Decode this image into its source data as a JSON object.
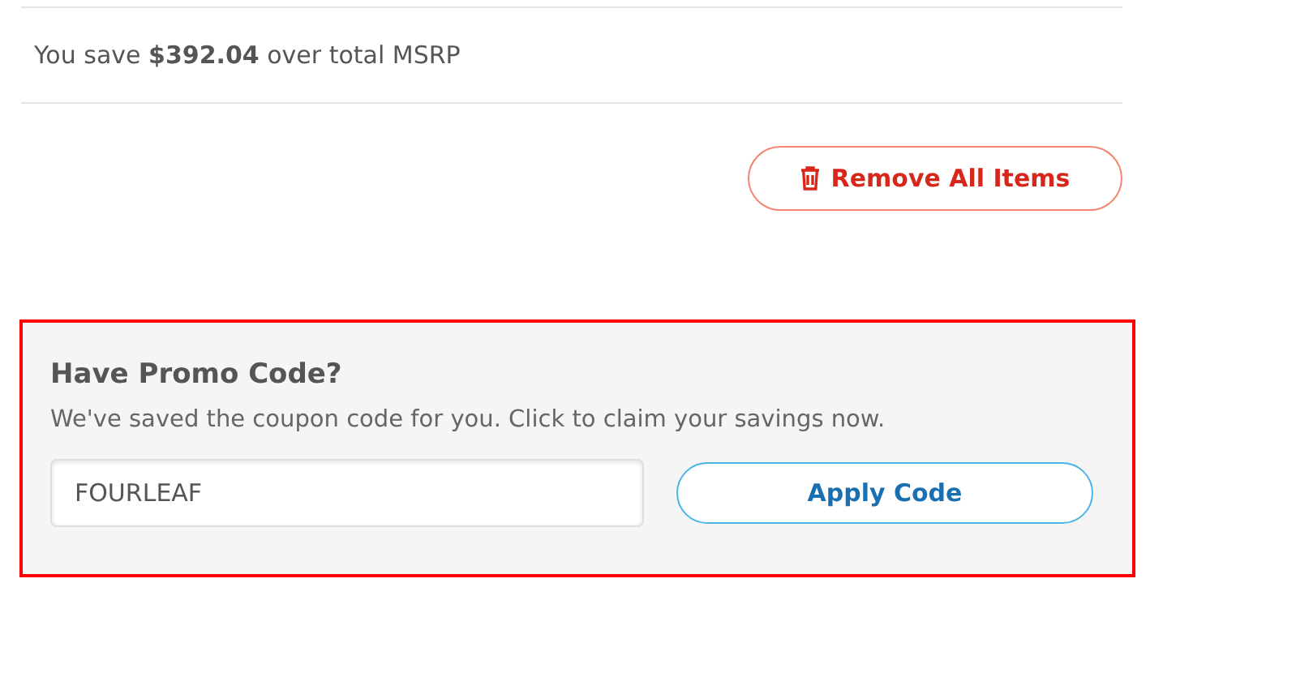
{
  "savings": {
    "text": "You save **$392.04** over total MSRP"
  },
  "remove_button": {
    "label": "Remove All Items"
  },
  "promo": {
    "highlighted": true,
    "title": "Have Promo Code?",
    "description": "We've saved the coupon code for you. Click to claim your savings now.",
    "code_value": "FOURLEAF",
    "apply_button": "Apply Code"
  }
}
